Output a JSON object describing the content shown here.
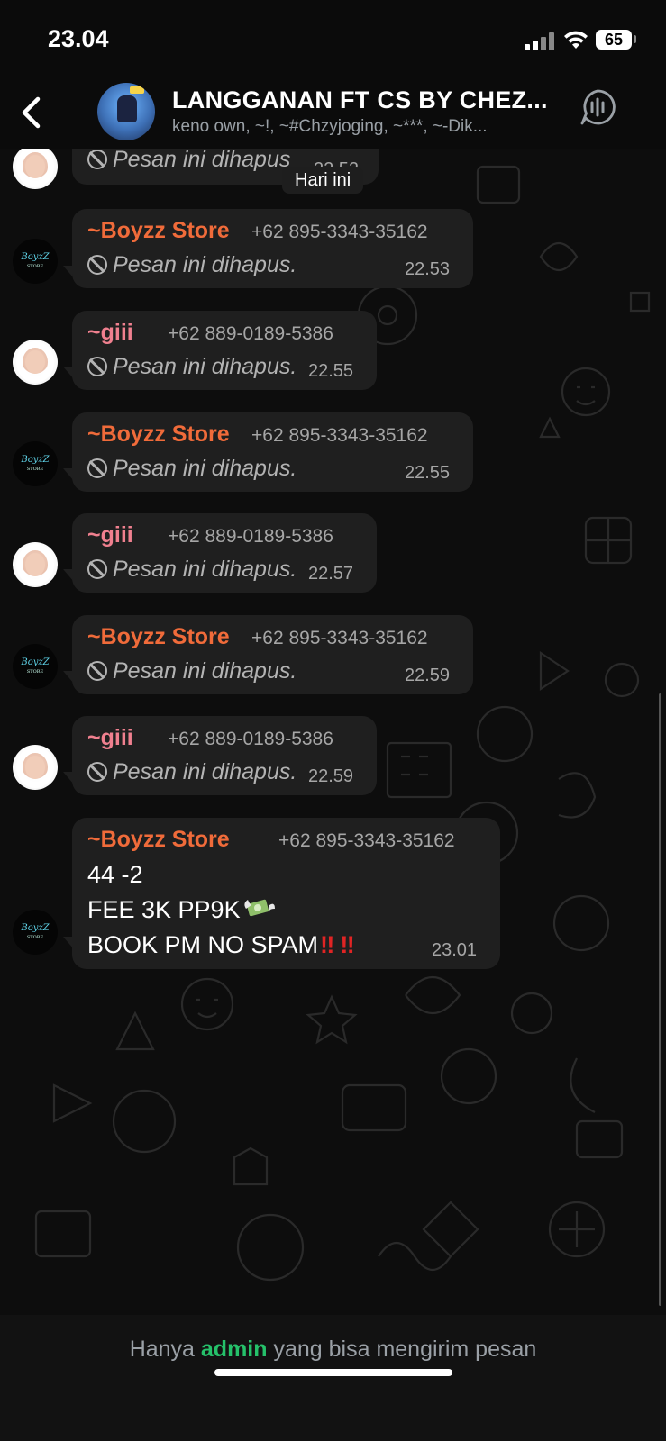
{
  "status": {
    "time": "23.04",
    "battery": "65"
  },
  "header": {
    "title": "LANGGANAN FT CS BY CHEZ...",
    "members": "keno own, ~!, ~#Chzyjoging, ~***, ~-Dik..."
  },
  "chat": {
    "date_chip": "Hari ini",
    "partial_message": {
      "deleted_text": "Pesan ini dihapus",
      "time": "22.52"
    },
    "messages": [
      {
        "sender": "~Boyzz Store",
        "phone": "+62 895-3343-35162",
        "text": "Pesan ini dihapus.",
        "time": "22.53"
      },
      {
        "sender": "~giii",
        "phone": "+62 889-0189-5386",
        "text": "Pesan ini dihapus.",
        "time": "22.55"
      },
      {
        "sender": "~Boyzz Store",
        "phone": "+62 895-3343-35162",
        "text": "Pesan ini dihapus.",
        "time": "22.55"
      },
      {
        "sender": "~giii",
        "phone": "+62 889-0189-5386",
        "text": "Pesan ini dihapus.",
        "time": "22.57"
      },
      {
        "sender": "~Boyzz Store",
        "phone": "+62 895-3343-35162",
        "text": "Pesan ini dihapus.",
        "time": "22.59"
      },
      {
        "sender": "~giii",
        "phone": "+62 889-0189-5386",
        "text": "Pesan ini dihapus.",
        "time": "22.59"
      }
    ],
    "last_message": {
      "sender": "~Boyzz Store",
      "phone": "+62 895-3343-35162",
      "line1": "44 -2",
      "line2": "FEE 3K PP9K",
      "line3": "BOOK PM NO SPAM",
      "time": "23.01"
    }
  },
  "footer": {
    "prefix": "Hanya ",
    "admin": "admin",
    "suffix": " yang bisa mengirim pesan"
  },
  "colors": {
    "sender_boyzz": "#f06b3a",
    "sender_giii": "#f0808f",
    "admin": "#25c16a",
    "bubble": "#1f1f1f"
  }
}
